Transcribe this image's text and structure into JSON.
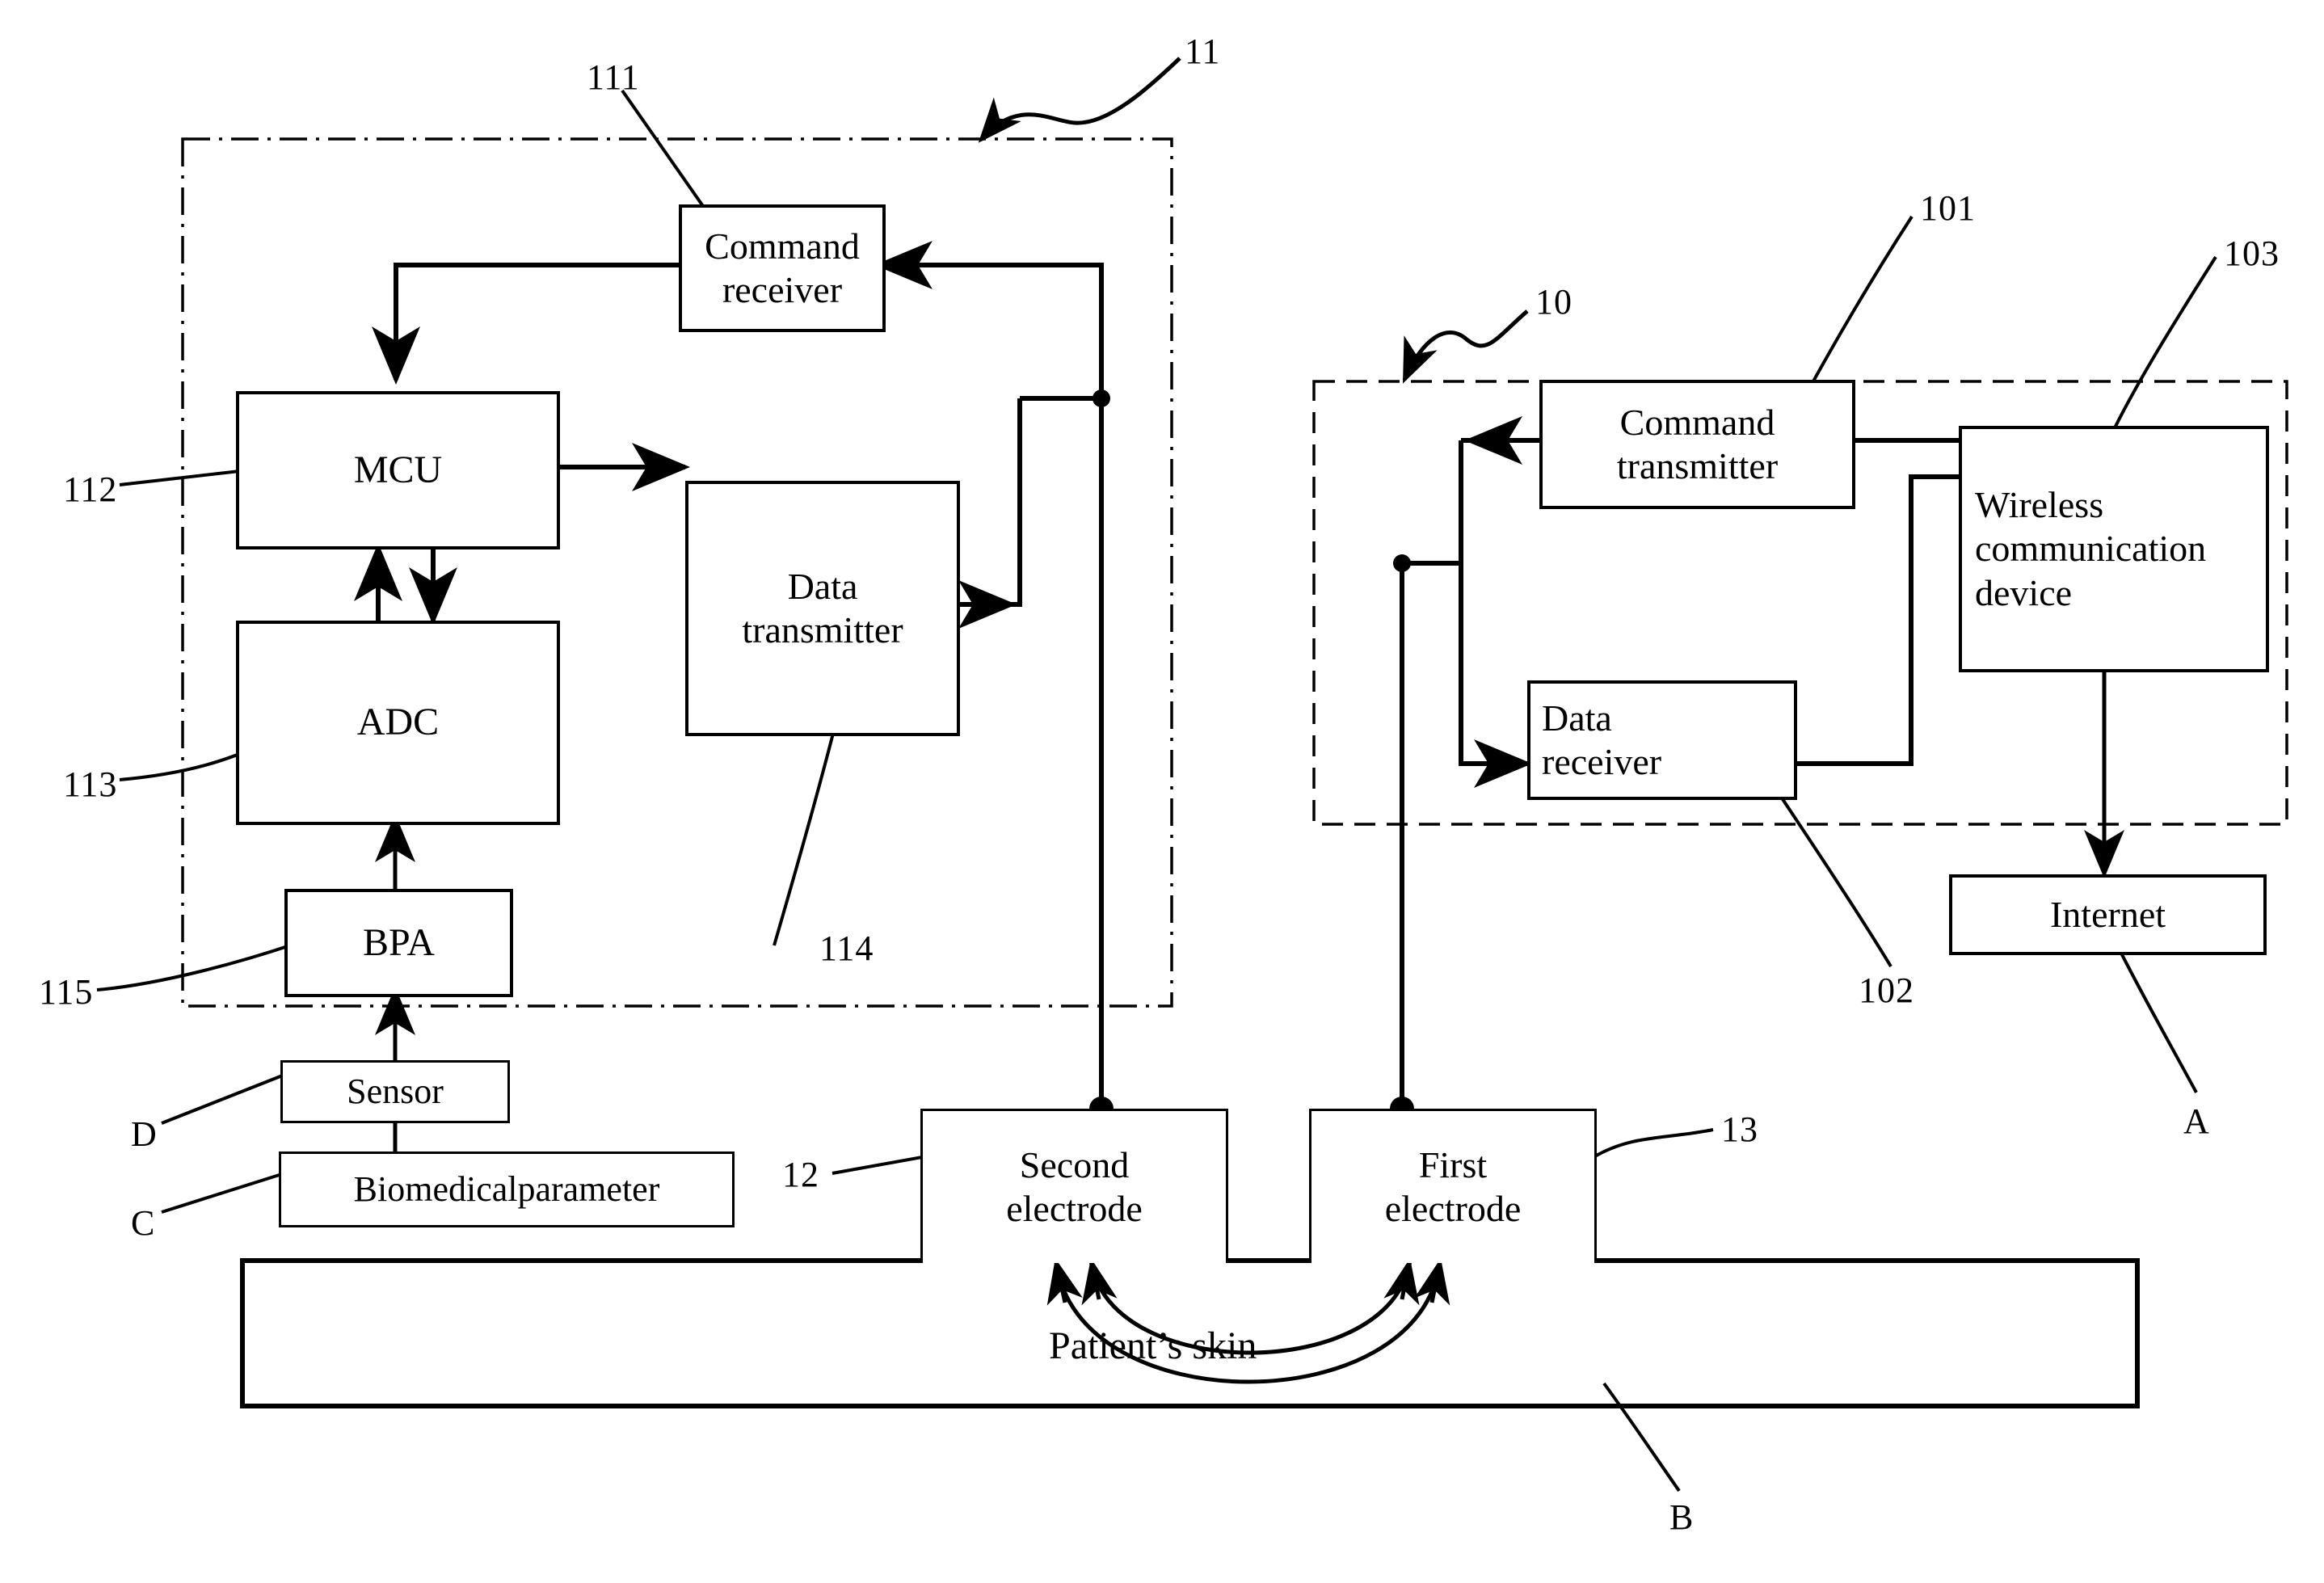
{
  "figure": {
    "type": "patent-block-diagram",
    "title": "Wireless biomedical monitoring system block diagram"
  },
  "modules": {
    "sensing_unit": {
      "ref": "11",
      "boundary_style": "dash-dot",
      "blocks": {
        "command_receiver": {
          "ref": "111",
          "label": "Command\nreceiver",
          "line1": "Command",
          "line2": "receiver"
        },
        "mcu": {
          "ref": "112",
          "label": "MCU"
        },
        "adc": {
          "ref": "113",
          "label": "ADC"
        },
        "data_transmitter": {
          "ref": "114",
          "label": "Data\ntransmitter",
          "line1": "Data",
          "line2": "transmitter"
        },
        "bpa": {
          "ref": "115",
          "label": "BPA"
        }
      }
    },
    "base_unit": {
      "ref": "10",
      "boundary_style": "dashed",
      "blocks": {
        "command_transmitter": {
          "ref": "101",
          "label": "Command\ntransmitter",
          "line1": "Command",
          "line2": "transmitter"
        },
        "data_receiver": {
          "ref": "102",
          "label": "Data\nreceiver",
          "line1": "Data",
          "line2": "receiver"
        },
        "wireless_communication_device": {
          "ref": "103",
          "label": "Wireless\ncommunication\ndevice",
          "line1": "Wireless",
          "line2": "communication",
          "line3": "device"
        }
      }
    }
  },
  "external_blocks": {
    "internet": {
      "ref": "A",
      "label": "Internet"
    },
    "sensor": {
      "ref": "D",
      "label": "Sensor"
    },
    "biomedical_parameter": {
      "ref": "C",
      "label": "Biomedicalparameter"
    },
    "second_electrode": {
      "ref": "12",
      "label": "Second\nelectrode",
      "line1": "Second",
      "line2": "electrode"
    },
    "first_electrode": {
      "ref": "13",
      "label": "First\nelectrode",
      "line1": "First",
      "line2": "electrode"
    },
    "patient_skin": {
      "ref": "B",
      "label": "Patient’s skin"
    }
  },
  "reference_numerals": {
    "n10": "10",
    "n101": "101",
    "n102": "102",
    "n103": "103",
    "n11": "11",
    "n111": "111",
    "n112": "112",
    "n113": "113",
    "n114": "114",
    "n115": "115",
    "n12": "12",
    "n13": "13",
    "A": "A",
    "B": "B",
    "C": "C",
    "D": "D"
  },
  "colors": {
    "ink": "#000000",
    "paper": "#ffffff"
  }
}
